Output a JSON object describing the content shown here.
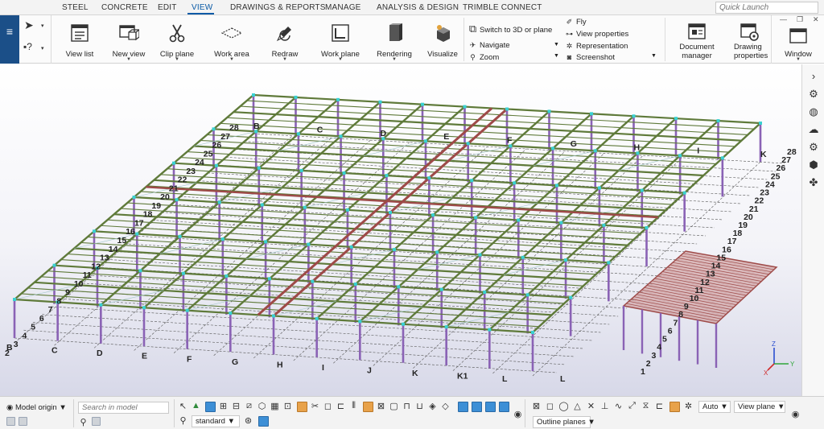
{
  "menu": {
    "items": [
      "STEEL",
      "CONCRETE",
      "EDIT",
      "VIEW",
      "DRAWINGS & REPORTS",
      "MANAGE",
      "ANALYSIS & DESIGN",
      "TRIMBLE CONNECT"
    ],
    "active": "VIEW",
    "quick_launch_placeholder": "Quick Launch"
  },
  "ribbon": {
    "view_list": "View list",
    "new_view": "New view",
    "clip_plane": "Clip plane",
    "work_area": "Work area",
    "redraw": "Redraw",
    "work_plane": "Work plane",
    "rendering": "Rendering",
    "visualize": "Visualize",
    "switch_3d": "Switch to 3D or plane",
    "navigate": "Navigate",
    "zoom": "Zoom",
    "fly": "Fly",
    "view_properties": "View properties",
    "representation": "Representation",
    "screenshot": "Screenshot",
    "document_manager_1": "Document",
    "document_manager_2": "manager",
    "drawing_properties_1": "Drawing",
    "drawing_properties_2": "properties",
    "window": "Window"
  },
  "grid": {
    "letters_front": [
      "B",
      "C",
      "D",
      "E",
      "F",
      "G",
      "H",
      "I",
      "J",
      "K",
      "K1",
      "L",
      "L"
    ],
    "letters_back": [
      "B",
      "C",
      "D",
      "E",
      "F",
      "G",
      "H",
      "I",
      "K"
    ],
    "numbers_left": [
      "2",
      "3",
      "4",
      "5",
      "6",
      "7",
      "8",
      "9",
      "10",
      "11",
      "12",
      "13",
      "14",
      "15",
      "16",
      "17",
      "18",
      "19",
      "20",
      "21",
      "22",
      "23",
      "24",
      "25",
      "26",
      "27",
      "28"
    ],
    "numbers_right": [
      "1",
      "2",
      "3",
      "4",
      "5",
      "6",
      "7",
      "8",
      "9",
      "10",
      "11",
      "12",
      "13",
      "14",
      "15",
      "16",
      "17",
      "18",
      "19",
      "20",
      "21",
      "22",
      "23",
      "24",
      "25",
      "26",
      "27",
      "28"
    ]
  },
  "axes": {
    "x": "X",
    "y": "Y",
    "z": "Z"
  },
  "status": {
    "model_origin": "Model origin",
    "search_placeholder": "Search in model",
    "standard": "standard",
    "auto": "Auto",
    "view_plane": "View plane",
    "outline_planes": "Outline planes"
  },
  "colors": {
    "beam_green": "#5f7a3a",
    "beam_red": "#9e4a48",
    "column_purple": "#8a62b5",
    "connection_cyan": "#39d1d1",
    "accent_blue": "#0a5aa6"
  }
}
